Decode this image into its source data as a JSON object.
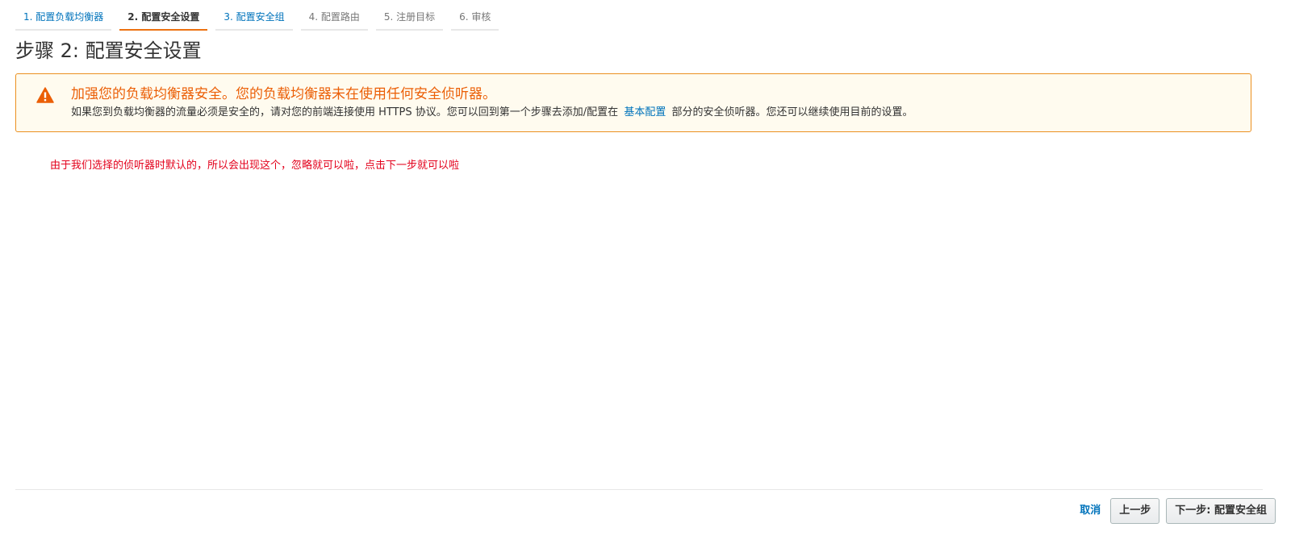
{
  "steps": [
    {
      "label": "1. 配置负载均衡器",
      "state": "link"
    },
    {
      "label": "2. 配置安全设置",
      "state": "current"
    },
    {
      "label": "3. 配置安全组",
      "state": "link"
    },
    {
      "label": "4. 配置路由",
      "state": "disabled"
    },
    {
      "label": "5. 注册目标",
      "state": "disabled"
    },
    {
      "label": "6. 审核",
      "state": "disabled"
    }
  ],
  "page_title": "步骤 2: 配置安全设置",
  "warning": {
    "icon": "warning-triangle-icon",
    "title": "加强您的负载均衡器安全。您的负载均衡器未在使用任何安全侦听器。",
    "body_before": "如果您到负载均衡器的流量必须是安全的，请对您的前端连接使用 HTTPS 协议。您可以回到第一个步骤去添加/配置在",
    "link": "基本配置",
    "body_after": "部分的安全侦听器。您还可以继续使用目前的设置。"
  },
  "annotation": "由于我们选择的侦听器时默认的，所以会出现这个，忽略就可以啦，点击下一步就可以啦",
  "footer": {
    "cancel": "取消",
    "previous": "上一步",
    "next": "下一步: 配置安全组"
  },
  "colors": {
    "link": "#0073bb",
    "accent": "#ec7211",
    "warning_border": "#eb9020",
    "warning_bg": "#fffbef",
    "warning_title": "#eb5f07",
    "annotation": "#e3001b"
  }
}
